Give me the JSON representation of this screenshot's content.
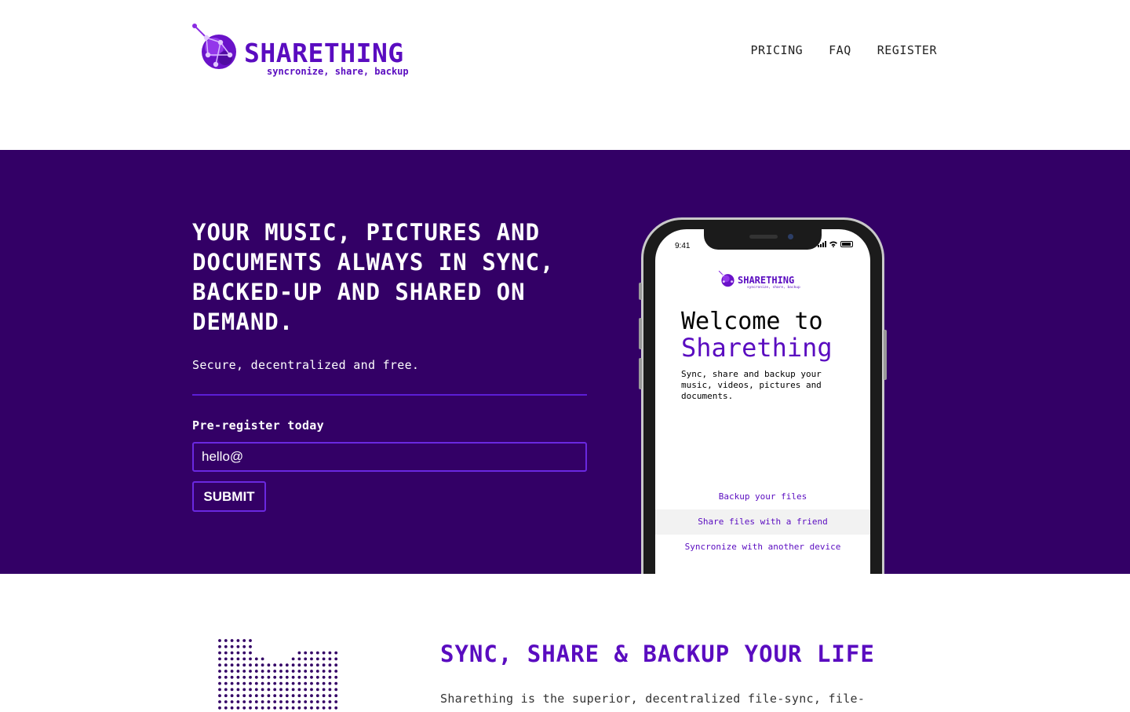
{
  "brand": {
    "name": "SHARETHING",
    "tagline": "syncronize, share, backup",
    "primary_color": "#5a0cc0",
    "hero_bg_color": "#330066"
  },
  "nav": {
    "items": [
      "PRICING",
      "FAQ",
      "REGISTER"
    ]
  },
  "hero": {
    "title": "YOUR MUSIC, PICTURES AND DOCUMENTS ALWAYS IN SYNC, BACKED-UP AND SHARED ON DEMAND.",
    "subtitle": "Secure, decentralized and free.",
    "prereg_label": "Pre-register today",
    "email_value": "hello@",
    "submit_label": "SUBMIT"
  },
  "phone": {
    "status_time": "9:41",
    "app_logo_title": "SHARETHING",
    "app_logo_tagline": "syncronize, share, backup",
    "welcome_line1": "Welcome to",
    "welcome_line2": "Sharething",
    "description": "Sync, share and backup your music, videos, pictures and documents.",
    "menu": [
      "Backup your files",
      "Share files with a friend",
      "Syncronize with another device"
    ]
  },
  "features": {
    "title": "SYNC, SHARE & BACKUP YOUR LIFE",
    "text": "Sharething is the superior, decentralized file-sync, file-"
  }
}
